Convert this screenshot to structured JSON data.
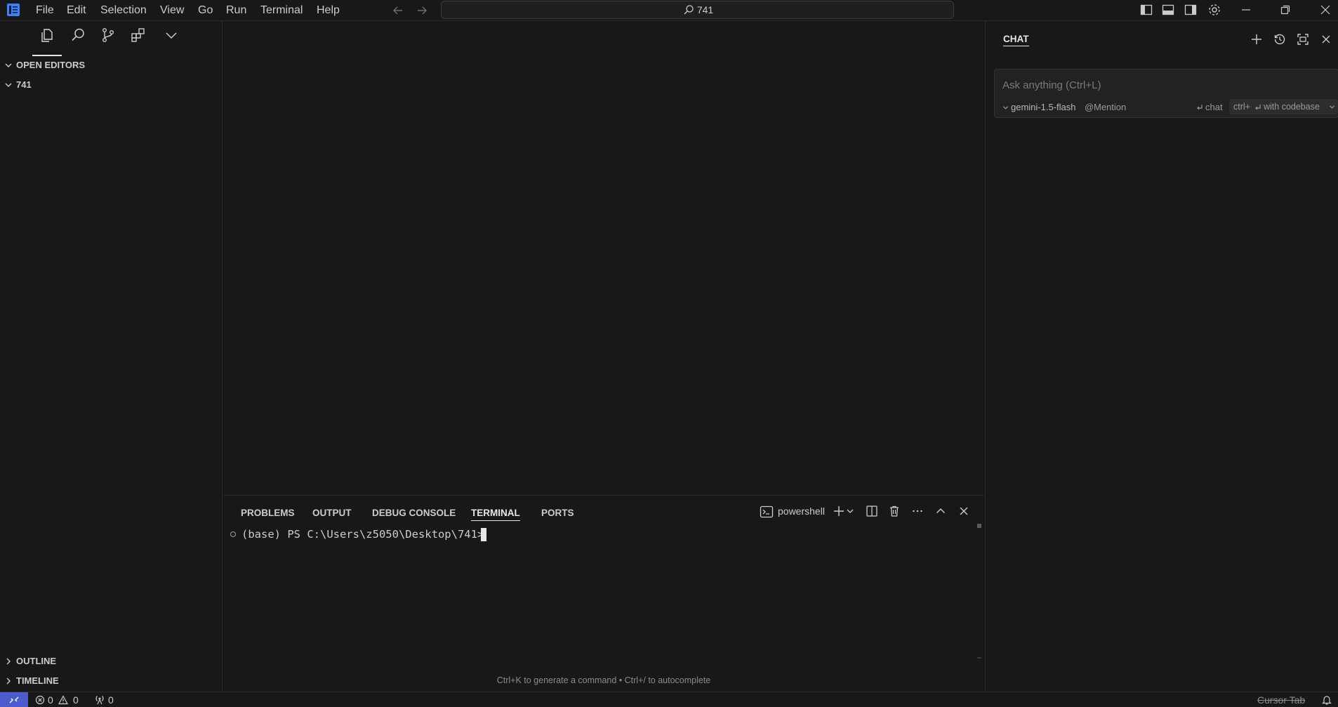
{
  "menu": [
    "File",
    "Edit",
    "Selection",
    "View",
    "Go",
    "Run",
    "Terminal",
    "Help"
  ],
  "search": {
    "text": "741"
  },
  "sidebar": {
    "open_editors": "OPEN EDITORS",
    "folder": "741",
    "outline": "OUTLINE",
    "timeline": "TIMELINE"
  },
  "panel": {
    "tabs": [
      "PROBLEMS",
      "OUTPUT",
      "DEBUG CONSOLE",
      "TERMINAL",
      "PORTS"
    ],
    "active_tab": "TERMINAL",
    "shell": "powershell",
    "prompt": "(base) PS C:\\Users\\z5050\\Desktop\\741>",
    "hint": "Ctrl+K to generate a command • Ctrl+/ to autocomplete"
  },
  "chat": {
    "title": "CHAT",
    "placeholder": "Ask anything (Ctrl+L)",
    "model": "gemini-1.5-flash",
    "mention": "Mention",
    "submit_label": "chat",
    "codebase_shortcut": "ctrl+",
    "codebase_label": "with codebase"
  },
  "status": {
    "errors": "0",
    "warnings": "0",
    "ports": "0",
    "cursor_tab": "Cursor Tab"
  },
  "colors": {
    "background": "#181818",
    "editor": "#1f1f1f",
    "remote": "#4d5bce",
    "accent": "#e7e7e7"
  }
}
